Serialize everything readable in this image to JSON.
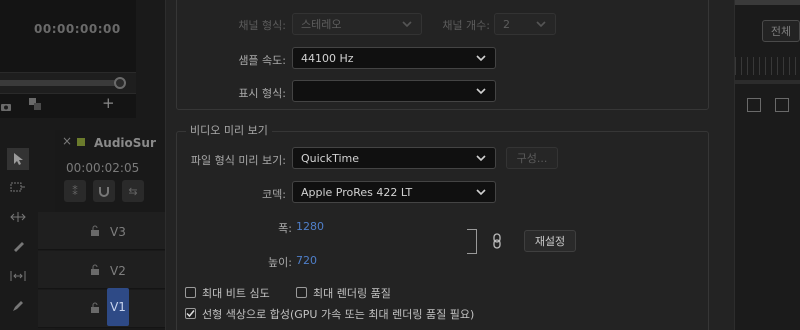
{
  "background": {
    "source_timecode": "00:00:00:00",
    "sequence_name": "AudioSur",
    "sequence_timecode": "00:00:02:05",
    "tracks": [
      {
        "label": "V3"
      },
      {
        "label": "V2"
      },
      {
        "label": "V1"
      }
    ],
    "right_button": "전체"
  },
  "dialog": {
    "audio": {
      "channel_format_label": "채널 형식:",
      "channel_format_value": "스테레오",
      "channel_count_label": "채널 개수:",
      "channel_count_value": "2",
      "sample_rate_label": "샘플 속도:",
      "sample_rate_value": "44100 Hz",
      "display_format_label": "표시 형식:",
      "display_format_value": ""
    },
    "video_preview": {
      "group_title": "비디오 미리 보기",
      "file_format_label": "파일 형식 미리 보기:",
      "file_format_value": "QuickTime",
      "configure_button": "구성...",
      "codec_label": "코덱:",
      "codec_value": "Apple ProRes 422 LT",
      "width_label": "폭:",
      "width_value": "1280",
      "height_label": "높이:",
      "height_value": "720",
      "reset_button": "재설정",
      "max_bit_depth_label": "최대 비트 심도",
      "max_bit_depth_checked": false,
      "max_render_quality_label": "최대 렌더링 품질",
      "max_render_quality_checked": false,
      "linear_color_label": "선형 색상으로 합성(GPU 가속 또는 최대 렌더링 품질 필요)",
      "linear_color_checked": true
    }
  },
  "colors": {
    "accent_blue": "#4f7fc9",
    "selected_track": "#2e4a86",
    "dialog_bg": "#232323"
  }
}
